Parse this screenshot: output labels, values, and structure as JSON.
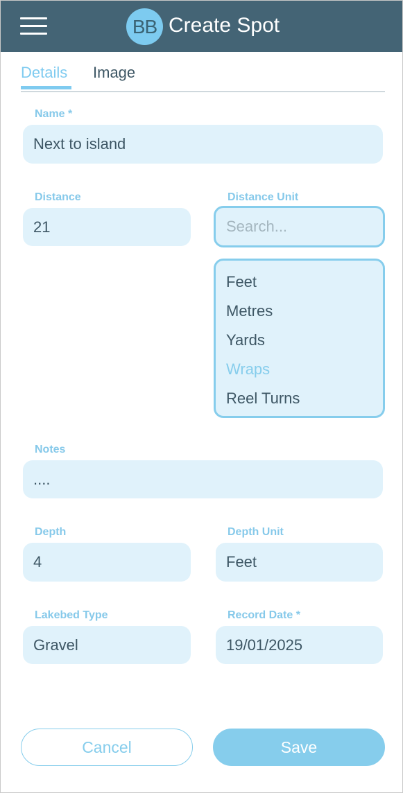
{
  "header": {
    "avatar_initials": "BB",
    "title": "Create Spot"
  },
  "tabs": [
    {
      "label": "Details",
      "active": true
    },
    {
      "label": "Image",
      "active": false
    }
  ],
  "form": {
    "name": {
      "label": "Name *",
      "value": "Next to island"
    },
    "distance": {
      "label": "Distance",
      "value": "21"
    },
    "distance_unit": {
      "label": "Distance Unit",
      "search_placeholder": "Search...",
      "options": [
        "Feet",
        "Metres",
        "Yards",
        "Wraps",
        "Reel Turns"
      ],
      "highlighted_option": "Wraps"
    },
    "notes": {
      "label": "Notes",
      "value": "...."
    },
    "depth": {
      "label": "Depth",
      "value": "4"
    },
    "depth_unit": {
      "label": "Depth Unit",
      "value": "Feet"
    },
    "lakebed_type": {
      "label": "Lakebed Type",
      "value": "Gravel"
    },
    "record_date": {
      "label": "Record Date *",
      "value": "19/01/2025"
    }
  },
  "actions": {
    "cancel_label": "Cancel",
    "save_label": "Save"
  },
  "colors": {
    "header_bg": "#446475",
    "accent": "#86cdec",
    "field_bg": "#e0f2fb",
    "text": "#3d5664"
  }
}
